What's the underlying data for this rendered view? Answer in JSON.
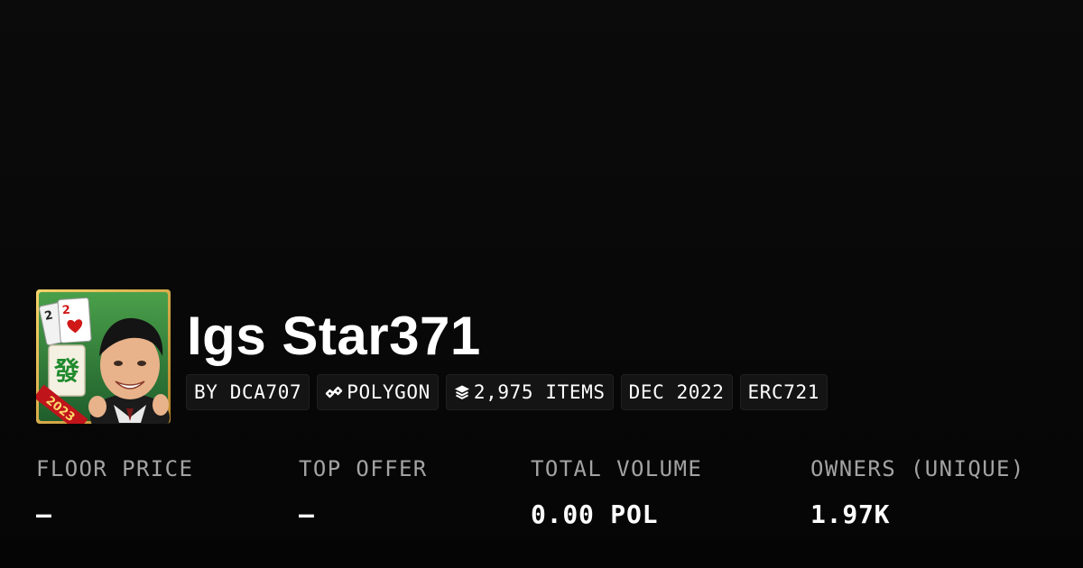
{
  "collection": {
    "name": "Igs Star371",
    "thumbnail_badge": "2023"
  },
  "tags": {
    "creator": "BY DCA707",
    "chain": "POLYGON",
    "items": "2,975 ITEMS",
    "date": "DEC 2022",
    "standard": "ERC721",
    "icons": {
      "chain": "link-icon",
      "items": "layers-icon"
    }
  },
  "stats": {
    "floor_price": {
      "label": "FLOOR PRICE",
      "value": "–"
    },
    "top_offer": {
      "label": "TOP OFFER",
      "value": "–"
    },
    "total_volume": {
      "label": "TOTAL VOLUME",
      "value": "0.00 POL"
    },
    "owners": {
      "label": "OWNERS (UNIQUE)",
      "value": "1.97K"
    }
  },
  "colors": {
    "background": "#0a0a0a",
    "text": "#ffffff",
    "muted": "#a3a3a3",
    "tag_background": "#141414"
  }
}
